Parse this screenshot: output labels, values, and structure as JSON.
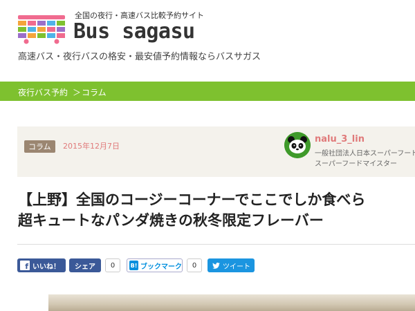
{
  "header": {
    "tagline": "全国の夜行・高速バス比較予約サイト",
    "logo_text": "Bus sagasu",
    "site_description": "高速バス・夜行バスの格安・最安値予約情報ならバスサガス"
  },
  "breadcrumb": {
    "items": [
      {
        "label": "夜行バス予約"
      },
      {
        "label": "コラム"
      }
    ],
    "separator": "＞"
  },
  "article": {
    "category_badge": "コラム",
    "date": "2015年12月7日",
    "author": {
      "name": "nalu_3_lin",
      "organization": "一般社団法人日本スーパーフード",
      "role": "スーパーフードマイスター",
      "avatar_icon": "panda-icon"
    },
    "title_lines": [
      "【上野】全国のコージーコーナーでここでしか食べら",
      "超キュートなパンダ焼きの秋冬限定フレーバー"
    ]
  },
  "share": {
    "facebook_like": {
      "label": "いいね！",
      "icon": "facebook-icon"
    },
    "facebook_share": {
      "label": "シェア",
      "count": "0"
    },
    "hatena": {
      "label": "ブックマーク",
      "icon_text": "B!",
      "count": "0"
    },
    "twitter": {
      "label": "ツイート",
      "icon": "twitter-bird-icon"
    }
  },
  "colors": {
    "accent_green": "#7ec12f",
    "badge_brown": "#9b8671",
    "date_pink": "#e07a7a",
    "facebook_blue": "#3b5998",
    "twitter_blue": "#1b95e0",
    "hatena_blue": "#008fde"
  }
}
